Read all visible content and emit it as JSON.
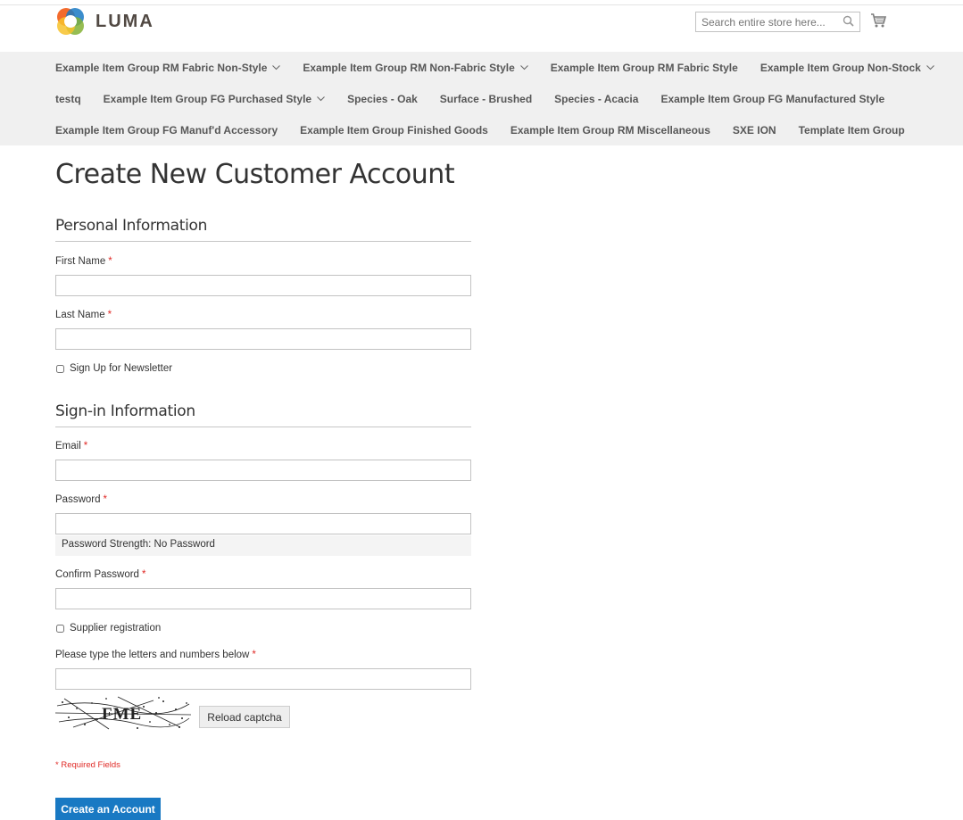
{
  "brand": {
    "logo_text": "LUMA"
  },
  "search": {
    "placeholder": "Search entire store here..."
  },
  "nav": {
    "row1": [
      {
        "label": "Example Item Group RM Fabric Non-Style",
        "has_children": true
      },
      {
        "label": "Example Item Group RM Non-Fabric Style",
        "has_children": true
      },
      {
        "label": "Example Item Group RM Fabric Style",
        "has_children": false
      },
      {
        "label": "Example Item Group Non-Stock",
        "has_children": true
      }
    ],
    "row2": [
      {
        "label": "testq",
        "has_children": false
      },
      {
        "label": "Example Item Group FG Purchased Style",
        "has_children": true
      },
      {
        "label": "Species - Oak",
        "has_children": false
      },
      {
        "label": "Surface - Brushed",
        "has_children": false
      },
      {
        "label": "Species - Acacia",
        "has_children": false
      },
      {
        "label": "Example Item Group FG Manufactured Style",
        "has_children": false
      }
    ],
    "row3": [
      {
        "label": "Example Item Group FG Manuf'd Accessory",
        "has_children": false
      },
      {
        "label": "Example Item Group Finished Goods",
        "has_children": false
      },
      {
        "label": "Example Item Group RM Miscellaneous",
        "has_children": false
      },
      {
        "label": "SXE ION",
        "has_children": false
      },
      {
        "label": "Template Item Group",
        "has_children": false
      }
    ]
  },
  "page": {
    "title": "Create New Customer Account"
  },
  "personal": {
    "legend": "Personal Information",
    "first_name_label": "First Name",
    "last_name_label": "Last Name",
    "newsletter_label": "Sign Up for Newsletter",
    "first_name_value": "",
    "last_name_value": ""
  },
  "signin": {
    "legend": "Sign-in Information",
    "email_label": "Email",
    "password_label": "Password",
    "password_strength": "Password Strength: No Password",
    "confirm_label": "Confirm Password",
    "supplier_label": "Supplier registration",
    "captcha_label": "Please type the letters and numbers below",
    "captcha_text": "FME",
    "reload_label": "Reload captcha"
  },
  "form": {
    "required_star": "*",
    "required_note": "* Required Fields",
    "submit_label": "Create an Account"
  },
  "colors": {
    "accent": "#1979c3",
    "required": "#e02b27",
    "nav_bg": "#f0f0f0"
  }
}
